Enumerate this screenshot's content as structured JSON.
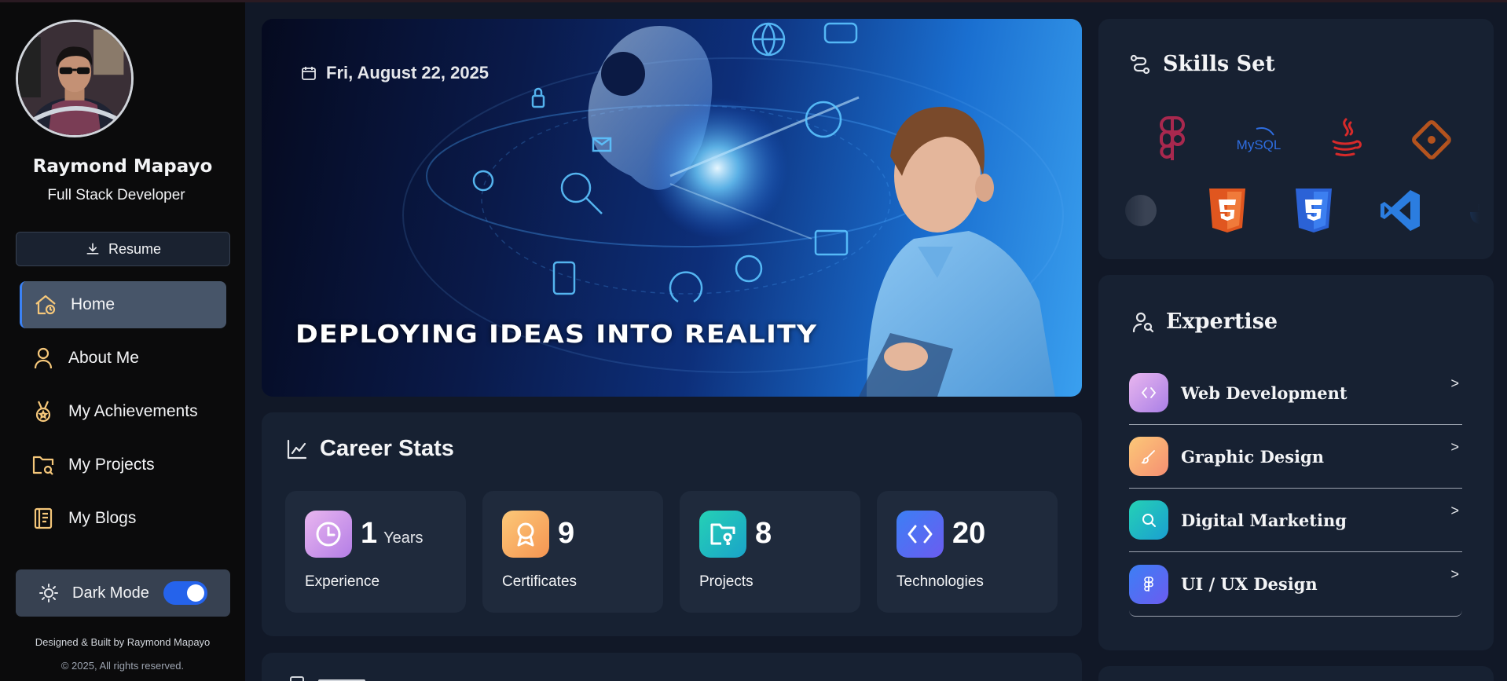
{
  "profile": {
    "name": "Raymond Mapayo",
    "role": "Full Stack Developer",
    "resume_label": "Resume"
  },
  "nav": {
    "items": [
      {
        "label": "Home",
        "icon": "home-icon",
        "active": true
      },
      {
        "label": "About Me",
        "icon": "user-icon"
      },
      {
        "label": "My Achievements",
        "icon": "medal-icon"
      },
      {
        "label": "My Projects",
        "icon": "folder-search-icon"
      },
      {
        "label": "My Blogs",
        "icon": "notebook-icon"
      }
    ]
  },
  "theme": {
    "dark_mode_label": "Dark Mode",
    "dark_mode_on": true
  },
  "footer": {
    "credit": "Designed & Built by Raymond Mapayo",
    "copyright": "© 2025, All rights reserved."
  },
  "hero": {
    "date": "Fri, August 22, 2025",
    "headline": "DEPLOYING IDEAS INTO REALITY"
  },
  "career": {
    "title": "Career Stats",
    "stats": [
      {
        "value": "1",
        "unit": "Years",
        "label": "Experience",
        "icon": "clock-icon"
      },
      {
        "value": "9",
        "unit": "",
        "label": "Certificates",
        "icon": "award-icon"
      },
      {
        "value": "8",
        "unit": "",
        "label": "Projects",
        "icon": "folder-key-icon"
      },
      {
        "value": "20",
        "unit": "",
        "label": "Technologies",
        "icon": "code-icon"
      }
    ]
  },
  "skills": {
    "title": "Skills Set",
    "row1": [
      "figma-icon",
      "mysql-icon",
      "java-icon",
      "git-icon"
    ],
    "row2": [
      "html5-icon",
      "css3-icon",
      "vscode-icon"
    ],
    "mysql_text": "MySQL"
  },
  "expertise": {
    "title": "Expertise",
    "items": [
      {
        "label": "Web Development",
        "icon": "code-icon"
      },
      {
        "label": "Graphic Design",
        "icon": "brush-icon"
      },
      {
        "label": "Digital Marketing",
        "icon": "search-icon"
      },
      {
        "label": "UI / UX Design",
        "icon": "figma-icon"
      }
    ],
    "chevron": ">"
  },
  "colors": {
    "accent": "#3b82f6",
    "sidebar_bg": "#0b0b0c",
    "card_bg": "#172132",
    "nav_icon": "#f5c77a"
  }
}
